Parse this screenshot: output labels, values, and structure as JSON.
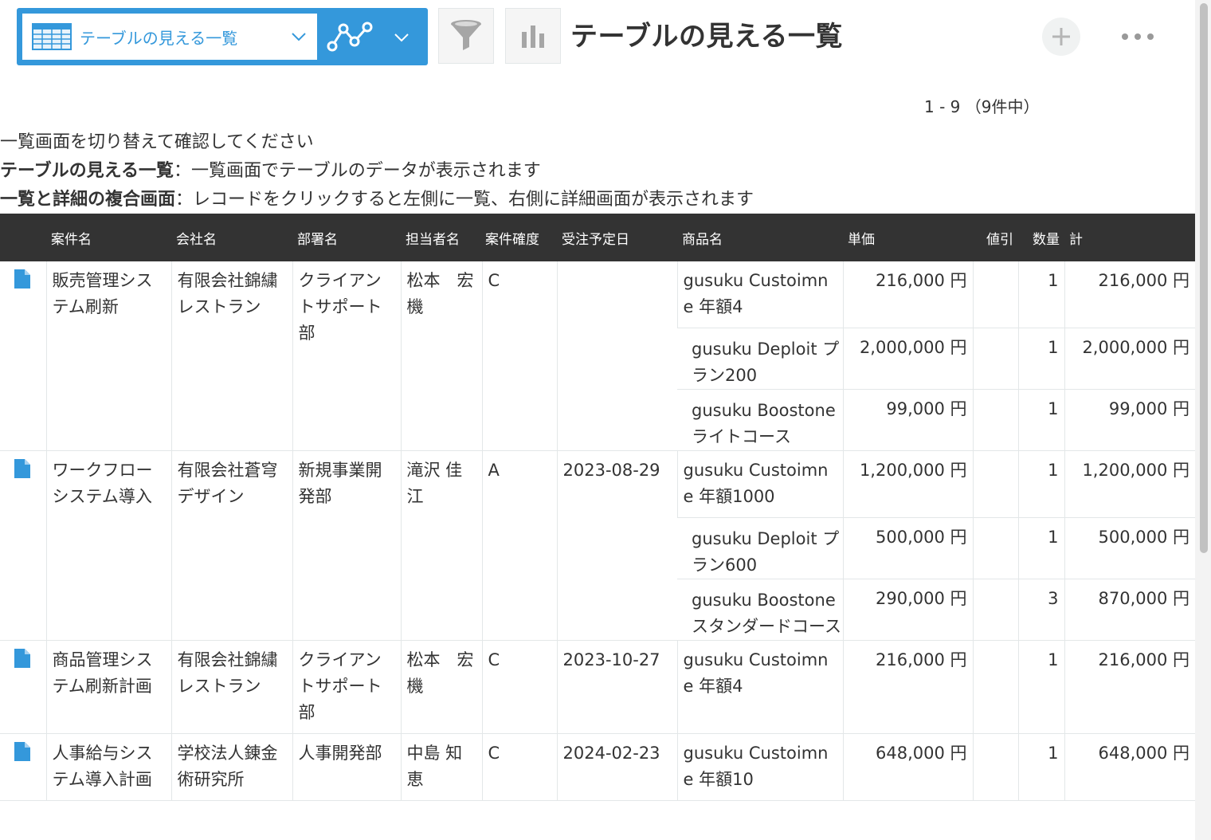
{
  "toolbar": {
    "view_name": "テーブルの見える一覧",
    "page_title": "テーブルの見える一覧",
    "icons": {
      "view": "table-icon",
      "dropdown": "chevron-down-icon",
      "graph": "line-graph-icon",
      "filter": "funnel-icon",
      "summary": "bar-chart-icon",
      "add": "plus-icon",
      "more": "ellipsis-icon"
    }
  },
  "pagination": "1 - 9 （9件中）",
  "description": {
    "line1": "一覧画面を切り替えて確認してください",
    "line2_label": "テーブルの見える一覧",
    "line2_text": "：一覧画面でテーブルのデータが表示されます",
    "line3_label": "一覧と詳細の複合画面",
    "line3_text": "：レコードをクリックすると左側に一覧、右側に詳細画面が表示されます"
  },
  "table": {
    "headers": [
      "",
      "案件名",
      "会社名",
      "部署名",
      "担当者名",
      "案件確度",
      "受注予定日",
      "商品名",
      "単価",
      "値引",
      "数量",
      "計"
    ],
    "records": [
      {
        "project": "販売管理システム刷新",
        "company": "有限会社錦繍レストラン",
        "department": "クライアントサポート部",
        "person": "松本　宏機",
        "certainty": "C",
        "date": "",
        "items": [
          {
            "product": "gusuku Custoimne 年額4",
            "price": "216,000 円",
            "discount": "",
            "qty": "1",
            "total": "216,000 円"
          },
          {
            "product": "gusuku Deploit プラン200",
            "price": "2,000,000 円",
            "discount": "",
            "qty": "1",
            "total": "2,000,000 円"
          },
          {
            "product": "gusuku Boostone ライトコース",
            "price": "99,000 円",
            "discount": "",
            "qty": "1",
            "total": "99,000 円"
          }
        ]
      },
      {
        "project": "ワークフローシステム導入",
        "company": "有限会社蒼穹デザイン",
        "department": "新規事業開発部",
        "person": "滝沢 佳江",
        "certainty": "A",
        "date": "2023-08-29",
        "items": [
          {
            "product": "gusuku Custoimne 年額1000",
            "price": "1,200,000 円",
            "discount": "",
            "qty": "1",
            "total": "1,200,000 円"
          },
          {
            "product": "gusuku Deploit プラン600",
            "price": "500,000 円",
            "discount": "",
            "qty": "1",
            "total": "500,000 円"
          },
          {
            "product": "gusuku Boostone スタンダードコース",
            "price": "290,000 円",
            "discount": "",
            "qty": "3",
            "total": "870,000 円"
          }
        ]
      },
      {
        "project": "商品管理システム刷新計画",
        "company": "有限会社錦繍レストラン",
        "department": "クライアントサポート部",
        "person": "松本　宏機",
        "certainty": "C",
        "date": "2023-10-27",
        "items": [
          {
            "product": "gusuku Custoimne 年額4",
            "price": "216,000 円",
            "discount": "",
            "qty": "1",
            "total": "216,000 円"
          }
        ]
      },
      {
        "project": "人事給与システム導入計画",
        "company": "学校法人錬金術研究所",
        "department": "人事開発部",
        "person": "中島 知恵",
        "certainty": "C",
        "date": "2024-02-23",
        "items": [
          {
            "product": "gusuku Custoimne 年額10",
            "price": "648,000 円",
            "discount": "",
            "qty": "1",
            "total": "648,000 円"
          }
        ]
      }
    ]
  }
}
